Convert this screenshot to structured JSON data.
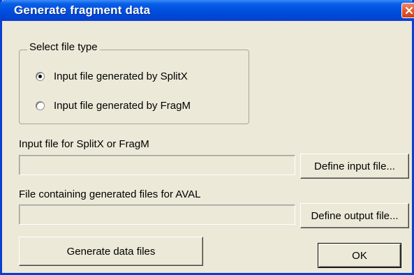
{
  "window": {
    "title": "Generate fragment data"
  },
  "file_type_group": {
    "legend": "Select file type",
    "options": [
      {
        "label": "Input file generated by SplitX",
        "checked": true
      },
      {
        "label": "Input file generated by FragM",
        "checked": false
      }
    ]
  },
  "input_file": {
    "label": "Input file for SplitX or FragM",
    "value": "",
    "button_label": "Define input file..."
  },
  "output_file": {
    "label": "File containing generated files for AVAL",
    "value": "",
    "button_label": "Define output file..."
  },
  "actions": {
    "generate_label": "Generate data files",
    "ok_label": "OK"
  },
  "icons": {
    "close": "close-icon"
  },
  "colors": {
    "titlebar": "#0052e0",
    "close_button": "#e35a30",
    "dialog_face": "#ece9d8"
  }
}
